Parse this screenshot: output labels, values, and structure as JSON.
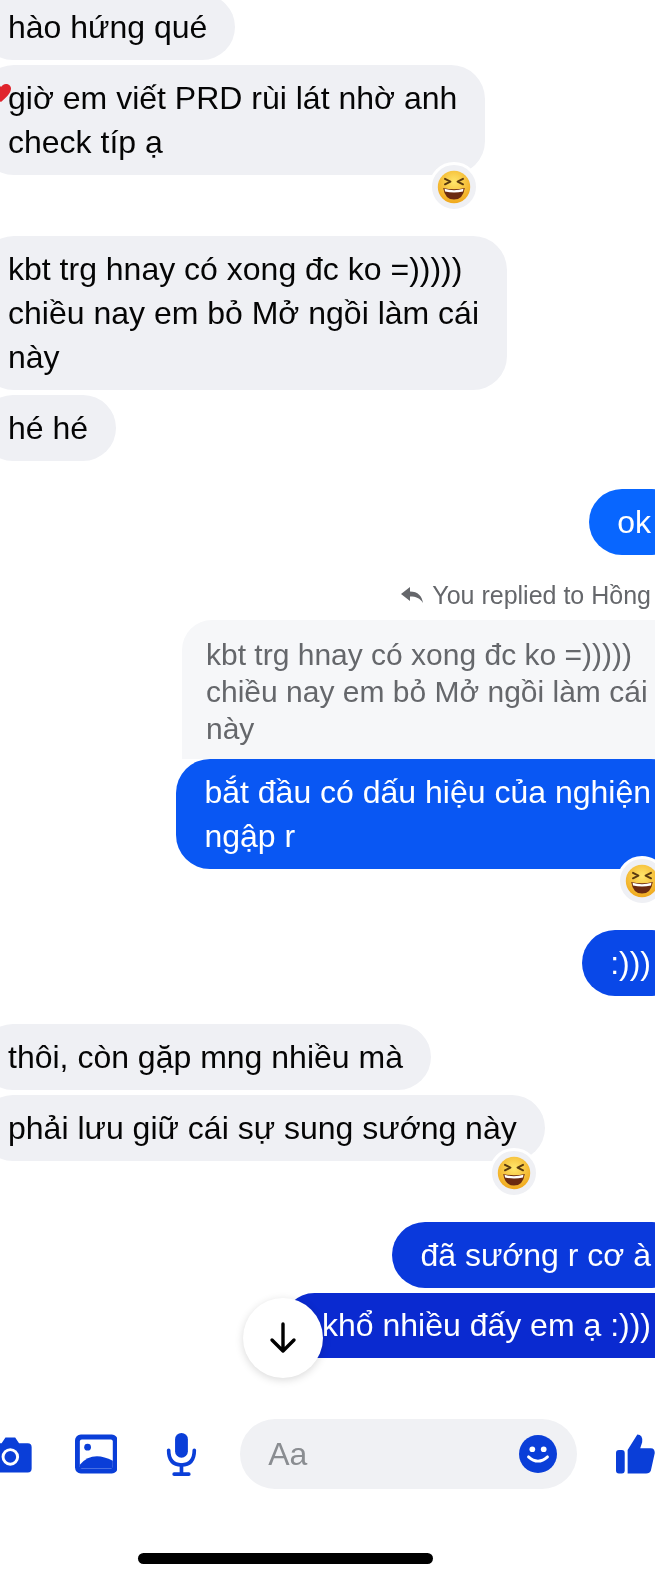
{
  "messages": [
    {
      "kind": "incoming",
      "lines": [
        "hào hứng qué"
      ]
    },
    {
      "kind": "incoming",
      "lines": [
        "giờ em viết PRD rùi lát nhờ anh",
        "check típ ạ"
      ],
      "heart": true,
      "reaction": true
    },
    {
      "kind": "incoming",
      "lines": [
        "kbt trg hnay có xong đc ko =)))))",
        "chiều nay em bỏ Mở ngồi làm cái",
        "này"
      ]
    },
    {
      "kind": "incoming",
      "lines": [
        "hé hé"
      ]
    },
    {
      "kind": "outgoing",
      "lines": [
        "ok"
      ]
    },
    {
      "kind": "reply_note",
      "text": "You replied to Hồng"
    },
    {
      "kind": "quoted",
      "lines": [
        "kbt trg hnay có xong đc ko =)))))",
        "chiều nay em bỏ Mở ngồi làm cái",
        "này"
      ]
    },
    {
      "kind": "outgoing",
      "lines": [
        "bắt đầu có dấu hiệu của nghiện",
        "ngập r"
      ],
      "reaction": true
    },
    {
      "kind": "outgoing",
      "lines": [
        ":)))"
      ]
    },
    {
      "kind": "incoming",
      "lines": [
        "thôi, còn gặp mng nhiều mà"
      ]
    },
    {
      "kind": "incoming",
      "lines": [
        "phải lưu giữ cái sự sung sướng này"
      ],
      "reaction": true
    },
    {
      "kind": "outgoing",
      "lines": [
        "đã sướng r cơ à"
      ]
    },
    {
      "kind": "outgoing",
      "lines": [
        "khổ nhiều đấy em ạ :)))"
      ]
    }
  ],
  "composer": {
    "placeholder": "Aa"
  }
}
